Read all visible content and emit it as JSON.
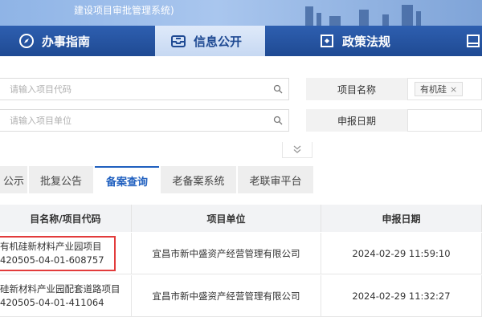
{
  "banner": {
    "title": "建设项目审批管理系统)"
  },
  "nav": [
    {
      "label": "办事指南",
      "icon": "compass-icon",
      "active": false
    },
    {
      "label": "信息公开",
      "icon": "inbox-icon",
      "active": true
    },
    {
      "label": "政策法规",
      "icon": "document-icon",
      "active": false
    }
  ],
  "filters": {
    "code_placeholder": "请输入项目代码",
    "unit_placeholder": "请输入项目单位",
    "project_name_label": "项目名称",
    "project_name_tag": "有机硅",
    "tag_remove": "×",
    "report_date_label": "申报日期"
  },
  "tabs": [
    {
      "label": "公示",
      "active": false
    },
    {
      "label": "批复公告",
      "active": false
    },
    {
      "label": "备案查询",
      "active": true
    },
    {
      "label": "老备案系统",
      "active": false
    },
    {
      "label": "老联审平台",
      "active": false
    }
  ],
  "table": {
    "headers": [
      "目名称/项目代码",
      "项目单位",
      "申报日期"
    ],
    "rows": [
      {
        "name": "有机硅新材料产业园项目",
        "code": "420505-04-01-608757",
        "unit": "宜昌市新中盛资产经营管理有限公司",
        "date": "2024-02-29 11:59:10"
      },
      {
        "name": "硅新材料产业园配套道路项目",
        "code": "420505-04-01-411064",
        "unit": "宜昌市新中盛资产经营管理有限公司",
        "date": "2024-02-29 11:32:27"
      }
    ]
  },
  "colors": {
    "nav_bg": "#2456a6",
    "accent": "#1f5fbf",
    "highlight": "#e23b3b"
  }
}
